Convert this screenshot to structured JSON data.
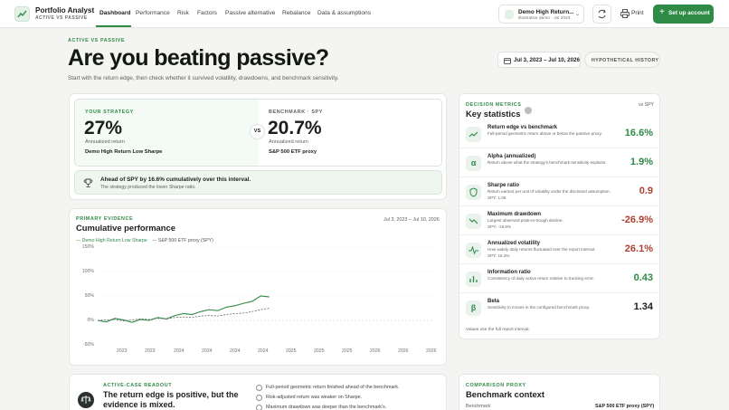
{
  "app": {
    "name": "Portfolio Analyst",
    "subtitle": "ACTIVE VS PASSIVE"
  },
  "nav": {
    "items": [
      "Dashboard",
      "Performance",
      "Risk",
      "Factors",
      "Passive alternative",
      "Rebalance",
      "Data & assumptions"
    ],
    "active": "Dashboard"
  },
  "demo_select": {
    "title": "Demo High Return...",
    "subtitle": "Illustrative demo · Jul 2023"
  },
  "actions": {
    "print_label": "Print",
    "setup_label": "Set up account"
  },
  "hero": {
    "eyebrow": "ACTIVE VS PASSIVE",
    "title": "Are you beating passive?",
    "subtitle": "Start with the return edge, then check whether it survived volatility, drawdowns, and benchmark sensitivity.",
    "date_range": "Jul 3, 2023 – Jul 10, 2026",
    "mode_label": "HYPOTHETICAL HISTORY"
  },
  "comparison": {
    "strategy": {
      "label": "YOUR STRATEGY",
      "value": "27%",
      "caption": "Annualized return",
      "name": "Demo High Return Low Sharpe"
    },
    "vs_label": "VS",
    "benchmark": {
      "label": "BENCHMARK · SPY",
      "value": "20.7%",
      "caption": "Annualized return",
      "name": "S&P 500 ETF proxy"
    },
    "ahead_title": "Ahead of SPY by 16.6% cumulatively over this interval.",
    "ahead_sub": "The strategy produced the lower Sharpe ratio."
  },
  "chart": {
    "eyebrow": "PRIMARY EVIDENCE",
    "title": "Cumulative performance",
    "date_range": "Jul 3, 2023 – Jul 10, 2026",
    "legend_strategy": "— Demo High Return Low Sharpe",
    "legend_benchmark": "--- S&P 500 ETF proxy (SPY)"
  },
  "chart_data": {
    "type": "line",
    "title": "Cumulative performance",
    "xlabel": "",
    "ylabel": "",
    "ylim": [
      -50,
      150
    ],
    "y_ticks": [
      "150%",
      "100%",
      "50%",
      "0%",
      "-50%"
    ],
    "x_ticks": [
      "2023",
      "2023",
      "2024",
      "2024",
      "2024",
      "2024",
      "2025",
      "2025",
      "2025",
      "2026",
      "2026",
      "2026"
    ],
    "legend": "top-left",
    "grid": true,
    "x": [
      0,
      4,
      8,
      12,
      16,
      20,
      24,
      28,
      32,
      36,
      40,
      44,
      48,
      52,
      56,
      60,
      64,
      68,
      72,
      76,
      80
    ],
    "series": [
      {
        "name": "Demo High Return Low Sharpe",
        "values": [
          0,
          -3,
          4,
          1,
          -4,
          2,
          0,
          6,
          3,
          10,
          14,
          12,
          18,
          22,
          20,
          27,
          30,
          35,
          39,
          50,
          48
        ],
        "color": "#2f8a45"
      },
      {
        "name": "S&P 500 ETF proxy (SPY)",
        "values": [
          0,
          1,
          2,
          -1,
          1,
          3,
          2,
          4,
          3,
          6,
          7,
          6,
          9,
          10,
          9,
          12,
          14,
          15,
          18,
          22,
          25
        ],
        "color": "#666666"
      }
    ]
  },
  "metrics": {
    "eyebrow": "DECISION METRICS",
    "title": "Key statistics",
    "vs_label": "vs SPY",
    "footnote": "Values use the full report interval.",
    "items": [
      {
        "icon": "trend-up-icon",
        "title": "Return edge vs benchmark",
        "desc": "Full-period geometric return above or below the passive proxy.",
        "sub": "",
        "value": "16.6%",
        "tone": "pos"
      },
      {
        "icon": "alpha-icon",
        "title": "Alpha (annualized)",
        "desc": "Return above what the strategy's benchmark sensitivity explains.",
        "sub": "",
        "value": "1.9%",
        "tone": "pos"
      },
      {
        "icon": "shield-icon",
        "title": "Sharpe ratio",
        "desc": "Return earned per unit of volatility under the disclosed assumption.",
        "sub": "SPY: 1.06",
        "value": "0.9",
        "tone": "neg"
      },
      {
        "icon": "trend-down-icon",
        "title": "Maximum drawdown",
        "desc": "Largest observed peak-to-trough decline.",
        "sub": "SPY: -15.8%",
        "value": "-26.9%",
        "tone": "neg"
      },
      {
        "icon": "pulse-icon",
        "title": "Annualized volatility",
        "desc": "How widely daily returns fluctuated over the report interval.",
        "sub": "SPY: 15.3%",
        "value": "26.1%",
        "tone": "neg"
      },
      {
        "icon": "bars-icon",
        "title": "Information ratio",
        "desc": "Consistency of daily active return relative to tracking error.",
        "sub": "",
        "value": "0.43",
        "tone": "pos"
      },
      {
        "icon": "beta-icon",
        "title": "Beta",
        "desc": "Sensitivity to moves in the configured benchmark proxy.",
        "sub": "",
        "value": "1.34",
        "tone": "neu"
      }
    ]
  },
  "readout": {
    "eyebrow": "ACTIVE-CASE READOUT",
    "title_line1": "The return edge is positive, but the",
    "title_line2": "evidence is mixed.",
    "checks": [
      "Full-period geometric return finished ahead of the benchmark.",
      "Risk-adjusted return was weaker on Sharpe.",
      "Maximum drawdown was deeper than the benchmark's."
    ]
  },
  "benchmark_context": {
    "eyebrow": "COMPARISON PROXY",
    "title": "Benchmark context",
    "row_label": "Benchmark",
    "row_value": "S&P 500 ETF proxy (SPY)"
  }
}
